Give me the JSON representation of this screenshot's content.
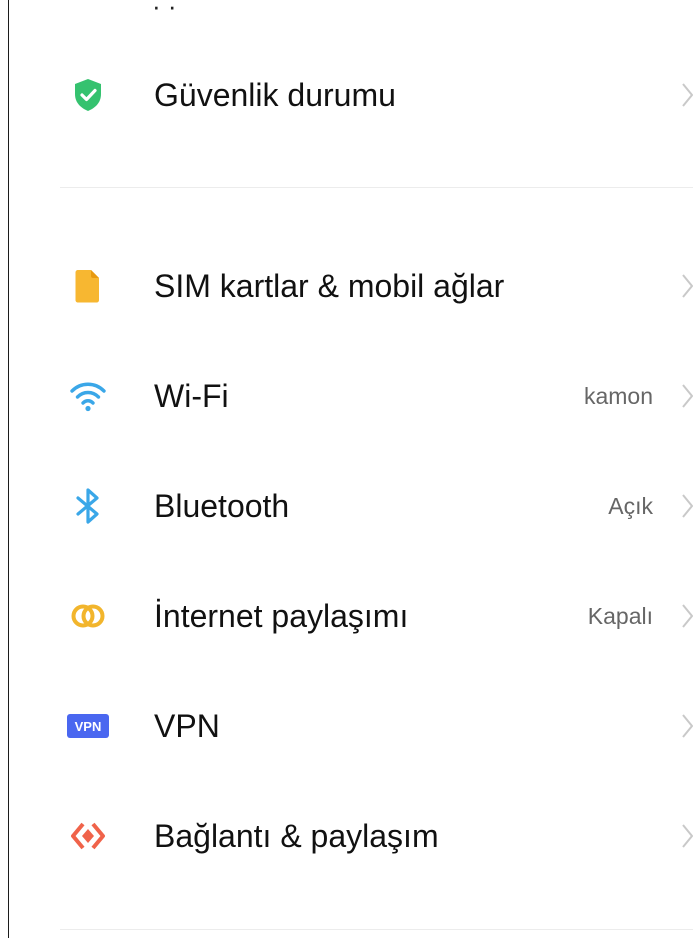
{
  "clipped_text": "· ·",
  "security": {
    "label": "Güvenlik durumu",
    "icon": "shield-check-icon",
    "color": "#35c26f"
  },
  "items": [
    {
      "label": "SIM kartlar & mobil ağlar",
      "value": "",
      "icon": "sim-card-icon",
      "color": "#f7b731"
    },
    {
      "label": "Wi-Fi",
      "value": "kamon",
      "icon": "wifi-icon",
      "color": "#3aa7e8"
    },
    {
      "label": "Bluetooth",
      "value": "Açık",
      "icon": "bluetooth-icon",
      "color": "#3aa7e8"
    },
    {
      "label": "İnternet paylaşımı",
      "value": "Kapalı",
      "icon": "hotspot-icon",
      "color": "#f2b52c"
    },
    {
      "label": "VPN",
      "value": "",
      "icon": "vpn-icon",
      "icon_text": "VPN",
      "color": "#4a67f0"
    },
    {
      "label": "Bağlantı & paylaşım",
      "value": "",
      "icon": "connection-share-icon",
      "color": "#f0634a"
    }
  ]
}
